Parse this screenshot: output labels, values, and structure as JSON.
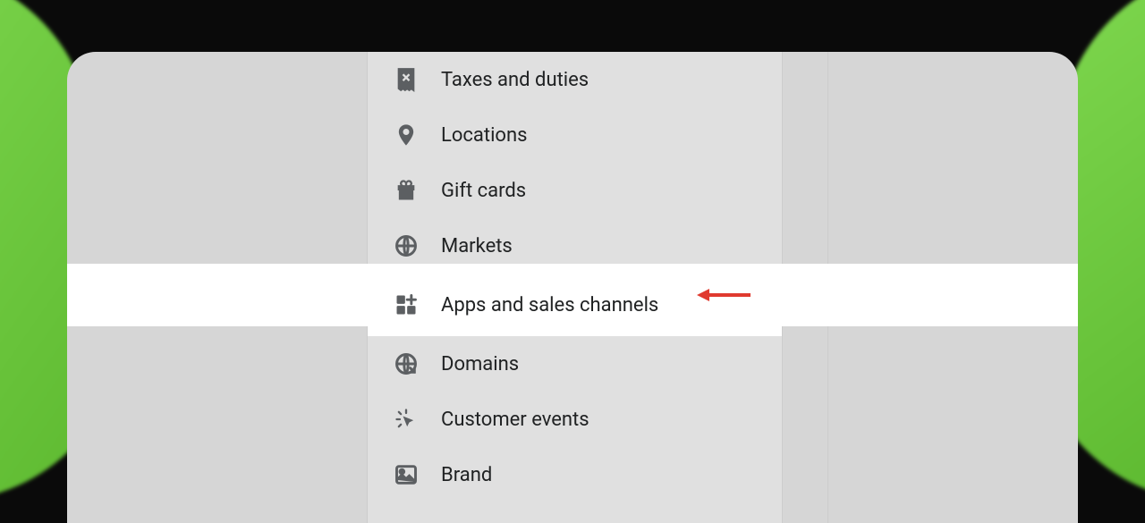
{
  "menu": {
    "items": [
      {
        "key": "taxes",
        "label": "Taxes and duties",
        "icon": "receipt-icon",
        "active": false
      },
      {
        "key": "locations",
        "label": "Locations",
        "icon": "location-icon",
        "active": false
      },
      {
        "key": "giftcards",
        "label": "Gift cards",
        "icon": "gift-icon",
        "active": false
      },
      {
        "key": "markets",
        "label": "Markets",
        "icon": "globe-icon",
        "active": false
      },
      {
        "key": "apps",
        "label": "Apps and sales channels",
        "icon": "apps-icon",
        "active": true
      },
      {
        "key": "domains",
        "label": "Domains",
        "icon": "globe-arrow-icon",
        "active": false
      },
      {
        "key": "events",
        "label": "Customer events",
        "icon": "cursor-click-icon",
        "active": false
      },
      {
        "key": "brand",
        "label": "Brand",
        "icon": "image-icon",
        "active": false
      }
    ]
  },
  "annotation": {
    "arrow_color": "#e03a2f"
  }
}
